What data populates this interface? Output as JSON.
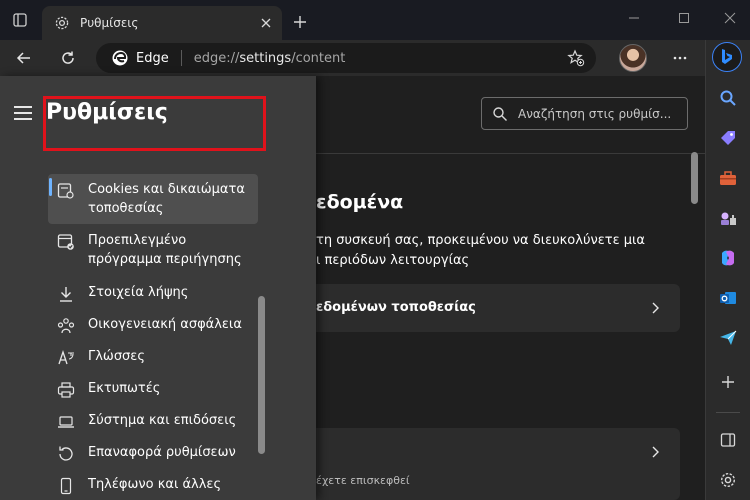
{
  "tab": {
    "title": "Ρυθμίσεις"
  },
  "address": {
    "site_name": "Edge",
    "url_prefix": "edge://",
    "url_bold": "settings",
    "url_suffix": "/content"
  },
  "settings": {
    "title": "Ρυθμίσεις",
    "search_placeholder": "Αναζήτηση στις ρυθμίσ...",
    "nav_items": [
      {
        "label": "Cookies και δικαιώματα τοποθεσίας",
        "icon": "cookie-permissions-icon",
        "selected": true
      },
      {
        "label": "Προεπιλεγμένο πρόγραμμα περιήγησης",
        "icon": "default-browser-icon"
      },
      {
        "label": "Στοιχεία λήψης",
        "icon": "download-icon"
      },
      {
        "label": "Οικογενειακή ασφάλεια",
        "icon": "family-icon"
      },
      {
        "label": "Γλώσσες",
        "icon": "languages-icon"
      },
      {
        "label": "Εκτυπωτές",
        "icon": "printer-icon"
      },
      {
        "label": "Σύστημα και επιδόσεις",
        "icon": "laptop-icon"
      },
      {
        "label": "Επαναφορά ρυθμίσεων",
        "icon": "reset-icon"
      },
      {
        "label": "Τηλέφωνο και άλλες",
        "icon": "phone-icon"
      }
    ]
  },
  "content": {
    "section_title_partial": "εδομένα",
    "section_desc_partial": "τη συσκευή σας, προκειμένου να διευκολύνετε μια\nι περιόδων λειτουργίας",
    "card1_label_partial": "εδομένων τοποθεσίας",
    "card2_sub_partial": "έχετε επισκεφθεί"
  },
  "colors": {
    "accent": "#6fb4ff",
    "highlight": "#e0121b"
  }
}
